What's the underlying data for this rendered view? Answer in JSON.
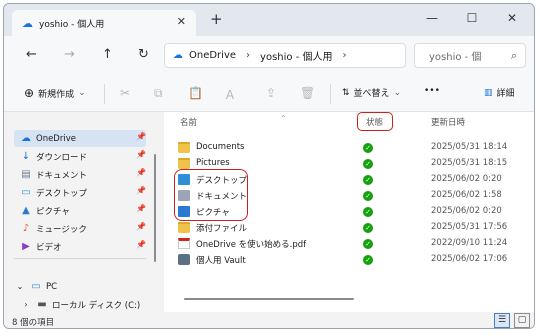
{
  "tab": {
    "title": "yoshio - 個人用",
    "close": "✕",
    "new": "+"
  },
  "window_controls": {
    "minimize": "—",
    "maximize": "☐",
    "close": "✕"
  },
  "nav": {
    "back": "←",
    "forward": "→",
    "up": "↑",
    "refresh": "↻"
  },
  "address": {
    "cloud": "☁",
    "part1": "OneDrive",
    "sep1": "›",
    "part2": "yoshio - 個人用",
    "sep2": "›"
  },
  "search": {
    "placeholder": "yoshio - 個",
    "icon": "⌕"
  },
  "toolbar": {
    "new_label": "新規作成",
    "new_icon": "⊕",
    "new_chevron": "⌄",
    "cut": "✂",
    "copy": "⧉",
    "paste": "📋",
    "rename": "Ａ",
    "share": "⇪",
    "delete": "🗑",
    "sort_label": "並べ替え",
    "sort_icon": "⇅",
    "sort_chevron": "⌄",
    "more": "•••",
    "details_label": "詳細",
    "details_icon": "▥"
  },
  "sidebar": {
    "items": [
      {
        "label": "OneDrive",
        "icon": "☁",
        "pinned": "📌"
      },
      {
        "label": "ダウンロード",
        "icon": "↓",
        "pinned": "📌"
      },
      {
        "label": "ドキュメント",
        "icon": "▤",
        "pinned": "📌"
      },
      {
        "label": "デスクトップ",
        "icon": "▭",
        "pinned": "📌"
      },
      {
        "label": "ピクチャ",
        "icon": "▲",
        "pinned": "📌"
      },
      {
        "label": "ミュージック",
        "icon": "♪",
        "pinned": "📌"
      },
      {
        "label": "ビデオ",
        "icon": "▶",
        "pinned": "📌"
      }
    ],
    "pc": {
      "label": "PC",
      "chevron": "⌄",
      "icon": "▭"
    },
    "local": {
      "label": "ローカル ディスク (C:)",
      "chevron": "›",
      "icon": "▬"
    }
  },
  "columns": {
    "name": "名前",
    "status": "状態",
    "date": "更新日時",
    "caret": "⌃"
  },
  "files": [
    {
      "name": "Documents",
      "type": "folder",
      "status": "✓",
      "date": "2025/05/31 18:14"
    },
    {
      "name": "Pictures",
      "type": "folder",
      "status": "✓",
      "date": "2025/05/31 18:15"
    },
    {
      "name": "デスクトップ",
      "type": "desk",
      "status": "✓",
      "date": "2025/06/02 0:20"
    },
    {
      "name": "ドキュメント",
      "type": "doc",
      "status": "✓",
      "date": "2025/06/02 1:58"
    },
    {
      "name": "ピクチャ",
      "type": "pic",
      "status": "✓",
      "date": "2025/06/02 0:20"
    },
    {
      "name": "添付ファイル",
      "type": "folder",
      "status": "✓",
      "date": "2025/05/31 17:56"
    },
    {
      "name": "OneDrive を使い始める.pdf",
      "type": "pdf",
      "status": "✓",
      "date": "2022/09/10 11:24"
    },
    {
      "name": "個人用 Vault",
      "type": "vault",
      "status": "✓",
      "date": "2025/06/02 17:06"
    }
  ],
  "statusbar": {
    "count": "8 個の項目",
    "view_details": "☰",
    "view_tiles": "▢"
  }
}
